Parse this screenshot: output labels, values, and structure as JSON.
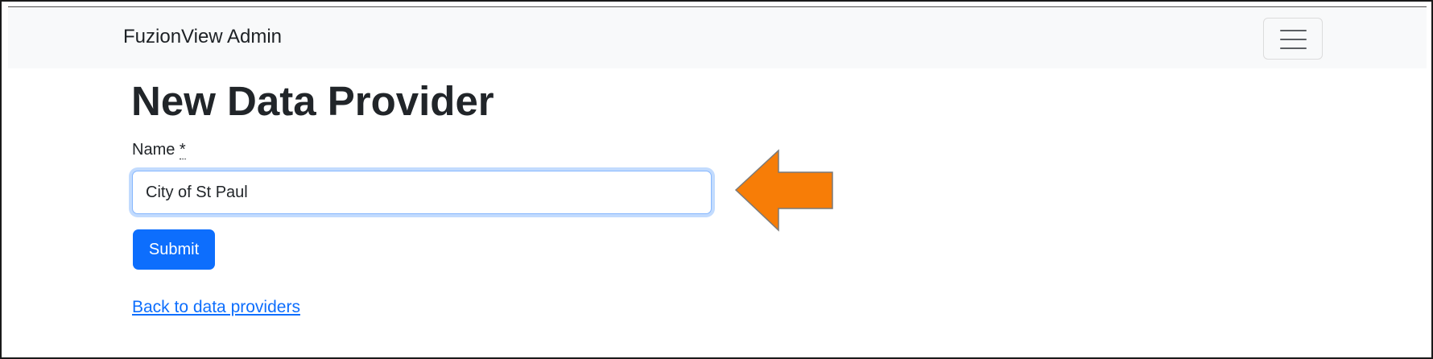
{
  "navbar": {
    "brand": "FuzionView Admin",
    "toggle_icon": "hamburger-menu-icon"
  },
  "page": {
    "title": "New Data Provider"
  },
  "form": {
    "name_label": "Name",
    "required_marker": "*",
    "name_value": "City of St Paul",
    "submit_label": "Submit"
  },
  "links": {
    "back": "Back to data providers"
  },
  "annotation": {
    "icon": "pointing-arrow-icon",
    "color": "#f77d07"
  },
  "colors": {
    "primary": "#0d6efd",
    "navbar_bg": "#f8f9fa",
    "text": "#212529"
  }
}
